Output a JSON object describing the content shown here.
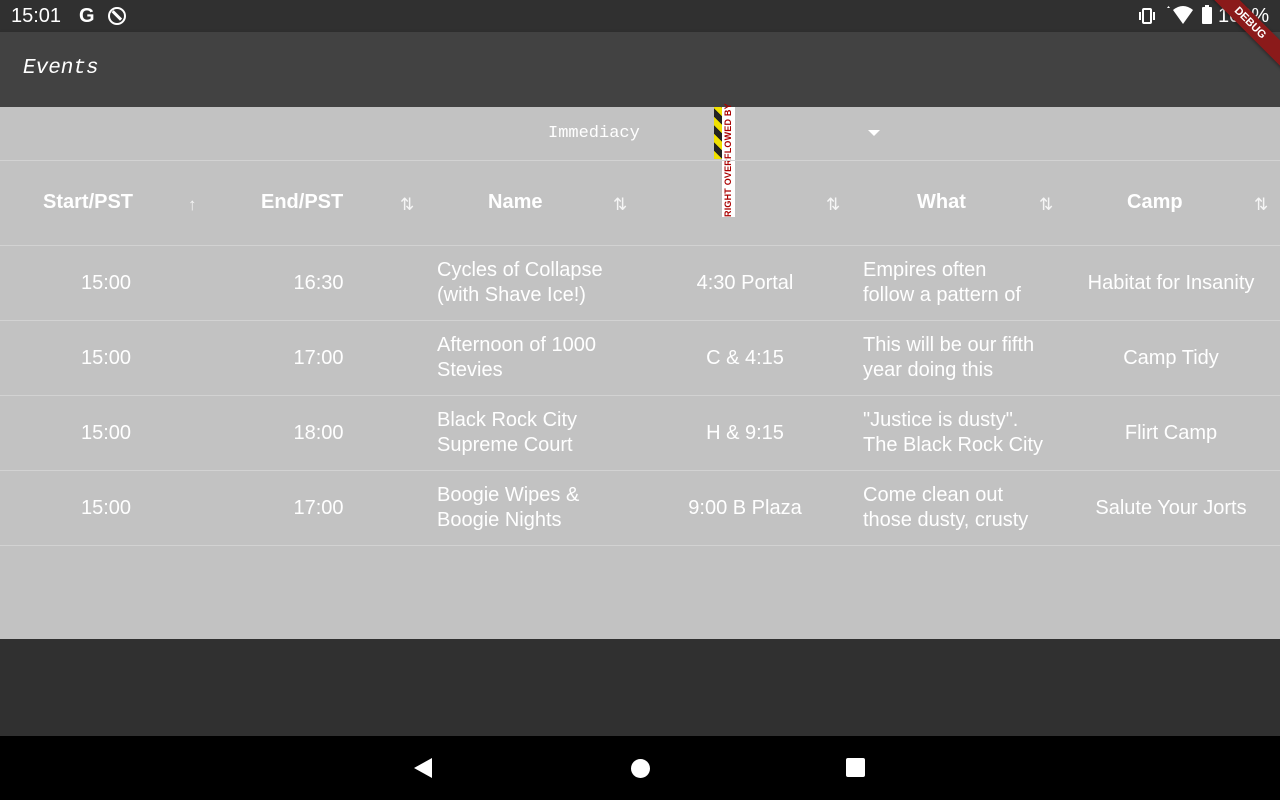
{
  "status_bar": {
    "time": "15:01",
    "g_label": "G",
    "battery_percent": "100%",
    "icons": [
      "g-icon",
      "do-not-disturb-icon",
      "vibrate-icon",
      "wifi-icon",
      "battery-icon"
    ]
  },
  "debug_banner": "DEBUG",
  "app_bar": {
    "title": "Events"
  },
  "filter": {
    "selected": "Immediacy"
  },
  "overflow_warning": "RIGHT OVERFLOWED BY",
  "table": {
    "columns": [
      {
        "label": "Start/PST",
        "sort": "ascending"
      },
      {
        "label": "End/PST",
        "sort": "none"
      },
      {
        "label": "Name",
        "sort": "none"
      },
      {
        "label": "",
        "sort": "none"
      },
      {
        "label": "What",
        "sort": "none"
      },
      {
        "label": "Camp",
        "sort": "none"
      }
    ],
    "rows": [
      {
        "start": "15:00",
        "end": "16:30",
        "name_1": "Cycles of Collapse",
        "name_2": "(with Shave Ice!)",
        "location": "4:30 Portal",
        "what_1": "Empires often",
        "what_2": "follow a pattern of",
        "camp": "Habitat for Insanity"
      },
      {
        "start": "15:00",
        "end": "17:00",
        "name_1": "Afternoon of 1000",
        "name_2": "Stevies",
        "location": "C & 4:15",
        "what_1": "This will be our fifth",
        "what_2": "year doing this",
        "camp": "Camp Tidy"
      },
      {
        "start": "15:00",
        "end": "18:00",
        "name_1": "Black Rock City",
        "name_2": "Supreme Court",
        "location": "H & 9:15",
        "what_1": "\"Justice is dusty\".",
        "what_2": "The Black Rock City",
        "camp": "Flirt Camp"
      },
      {
        "start": "15:00",
        "end": "17:00",
        "name_1": "Boogie Wipes &",
        "name_2": "Boogie Nights",
        "location": "9:00 B Plaza",
        "what_1": "Come clean out",
        "what_2": "those dusty, crusty",
        "camp": "Salute Your Jorts"
      }
    ]
  },
  "nav": {
    "icons": [
      "back-icon",
      "home-icon",
      "recents-icon"
    ]
  }
}
